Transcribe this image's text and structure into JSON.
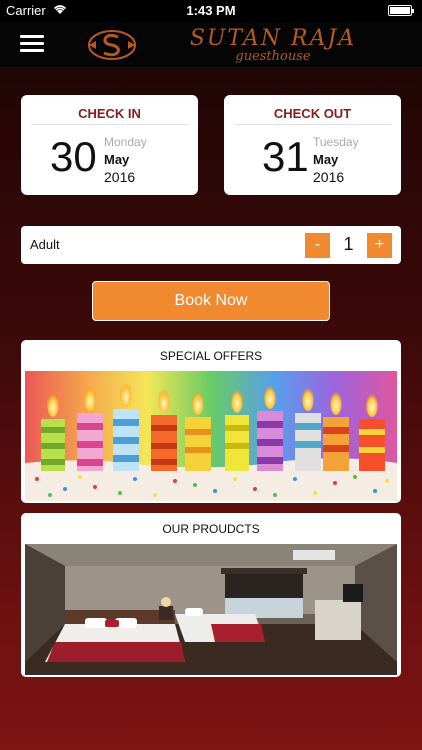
{
  "status_bar": {
    "carrier": "Carrier",
    "time": "1:43 PM",
    "battery_level": 1.0
  },
  "header": {
    "brand_name": "SUTAN RAJA",
    "brand_sub": "guesthouse",
    "brand_color": "#b85a1e"
  },
  "check_in": {
    "label": "CHECK IN",
    "day": "30",
    "weekday": "Monday",
    "month": "May",
    "year": "2016"
  },
  "check_out": {
    "label": "CHECK OUT",
    "day": "31",
    "weekday": "Tuesday",
    "month": "May",
    "year": "2016"
  },
  "guests": {
    "label": "Adult",
    "minus_label": "-",
    "plus_label": "+",
    "count": "1"
  },
  "book_button": {
    "label": "Book Now"
  },
  "sections": {
    "offers_title": "SPECIAL OFFERS",
    "products_title": "OUR PROUDCTS"
  },
  "colors": {
    "accent": "#f0892f",
    "label": "#8b1a1a",
    "background": "#5a0d0d"
  }
}
